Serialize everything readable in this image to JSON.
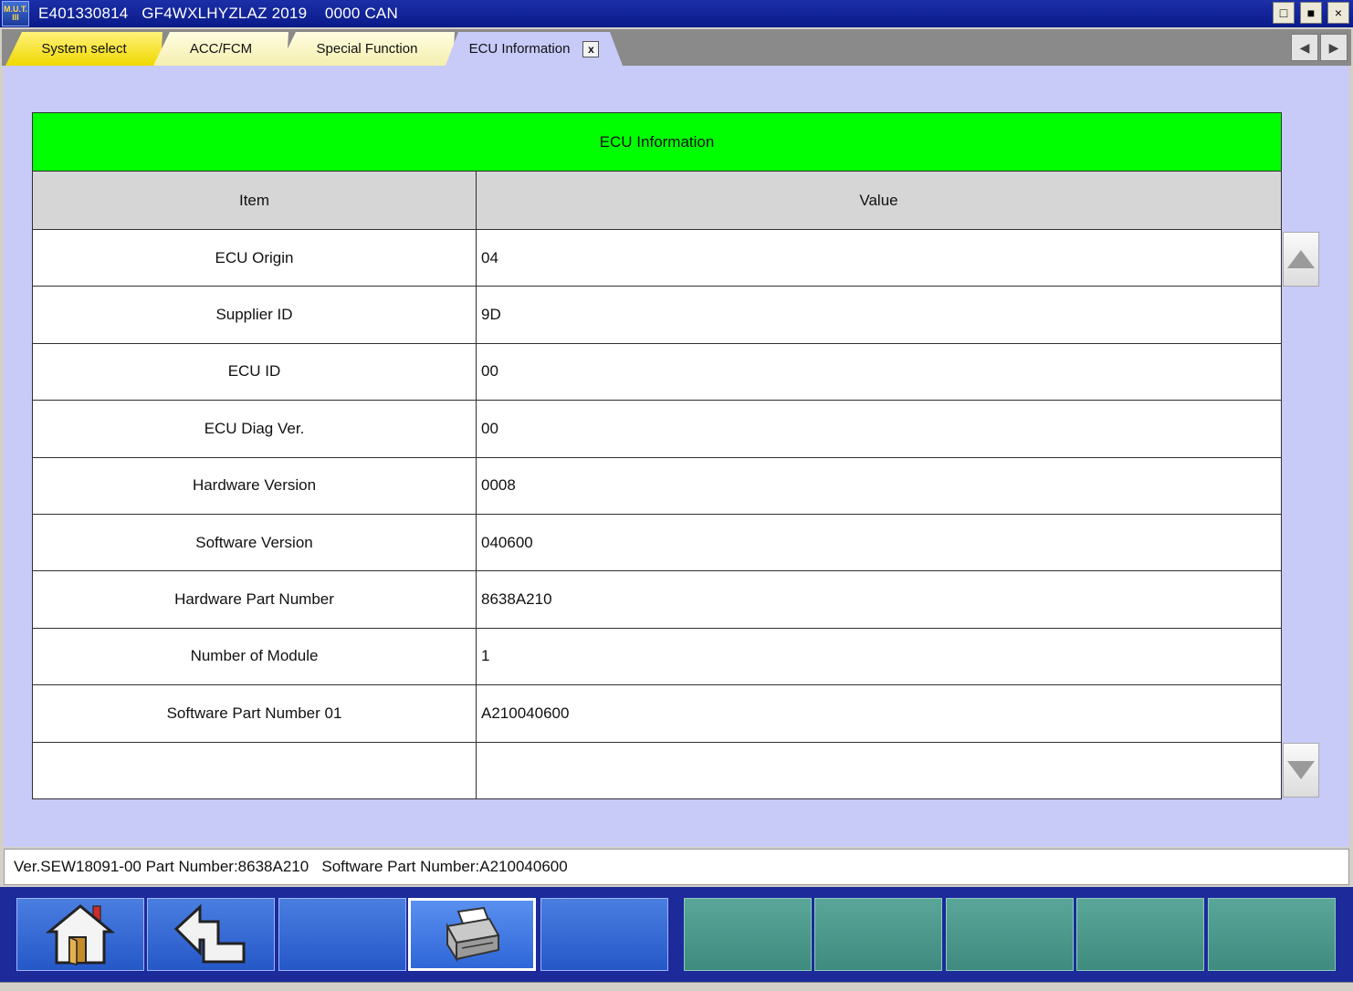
{
  "titlebar": {
    "logo": "M.U.T. III",
    "title": "E401330814   GF4WXLHYZLAZ 2019    0000 CAN",
    "buttons": [
      "□",
      "■",
      "×"
    ]
  },
  "tabs": [
    {
      "label": "System select"
    },
    {
      "label": "ACC/FCM"
    },
    {
      "label": "Special Function"
    },
    {
      "label": "ECU Information",
      "close": "x"
    }
  ],
  "tab_arrows": {
    "left": "◀",
    "right": "▶"
  },
  "table": {
    "caption": "ECU Information",
    "headers": {
      "item": "Item",
      "value": "Value"
    },
    "rows": [
      {
        "item": "ECU Origin",
        "value": "04"
      },
      {
        "item": "Supplier ID",
        "value": "9D"
      },
      {
        "item": "ECU ID",
        "value": "00"
      },
      {
        "item": "ECU Diag Ver.",
        "value": "00"
      },
      {
        "item": "Hardware Version",
        "value": "0008"
      },
      {
        "item": "Software Version",
        "value": "040600"
      },
      {
        "item": "Hardware Part Number",
        "value": "8638A210"
      },
      {
        "item": "Number of Module",
        "value": "1"
      },
      {
        "item": "Software Part Number 01",
        "value": "A210040600"
      },
      {
        "item": "",
        "value": ""
      }
    ]
  },
  "status": "Ver.SEW18091-00 Part Number:8638A210   Software Part Number:A210040600",
  "toolbar": {
    "icons": [
      "home-icon",
      "back-icon",
      "",
      "print-icon",
      ""
    ]
  },
  "colors": {
    "caption_bg": "#00ff00",
    "content_bg": "#c8caf8",
    "toolbar_bg": "#1c2a9a"
  }
}
